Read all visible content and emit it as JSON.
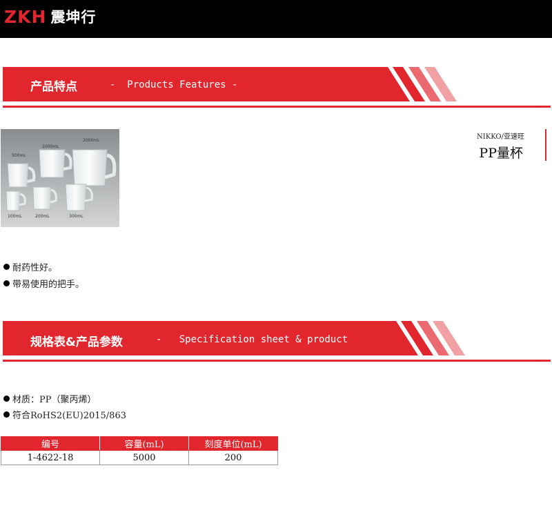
{
  "header": {
    "logo_mark": "ZKH",
    "logo_name": "震坤行"
  },
  "features_banner": {
    "title_cn": "产品特点",
    "title_en": "-  Products Features -"
  },
  "product": {
    "brand": "NIKKO/亚速旺",
    "name": "PP量杯",
    "image_labels": [
      "2000mL",
      "1000mL",
      "500mL",
      "100mL",
      "200mL",
      "300mL"
    ]
  },
  "features": [
    "耐药性好。",
    "带易使用的把手。"
  ],
  "spec_banner": {
    "title_cn": "规格表&产品参数",
    "title_en": "-   Specification sheet & product"
  },
  "spec_notes": [
    "材质：PP（聚丙烯）",
    "符合RoHS2(EU)2015/863"
  ],
  "spec_table": {
    "headers": [
      "编号",
      "容量(mL)",
      "刻度单位(mL)"
    ],
    "rows": [
      [
        "1-4622-18",
        "5000",
        "200"
      ]
    ]
  },
  "colors": {
    "accent": "#e1262d",
    "topbar": "#000000"
  }
}
